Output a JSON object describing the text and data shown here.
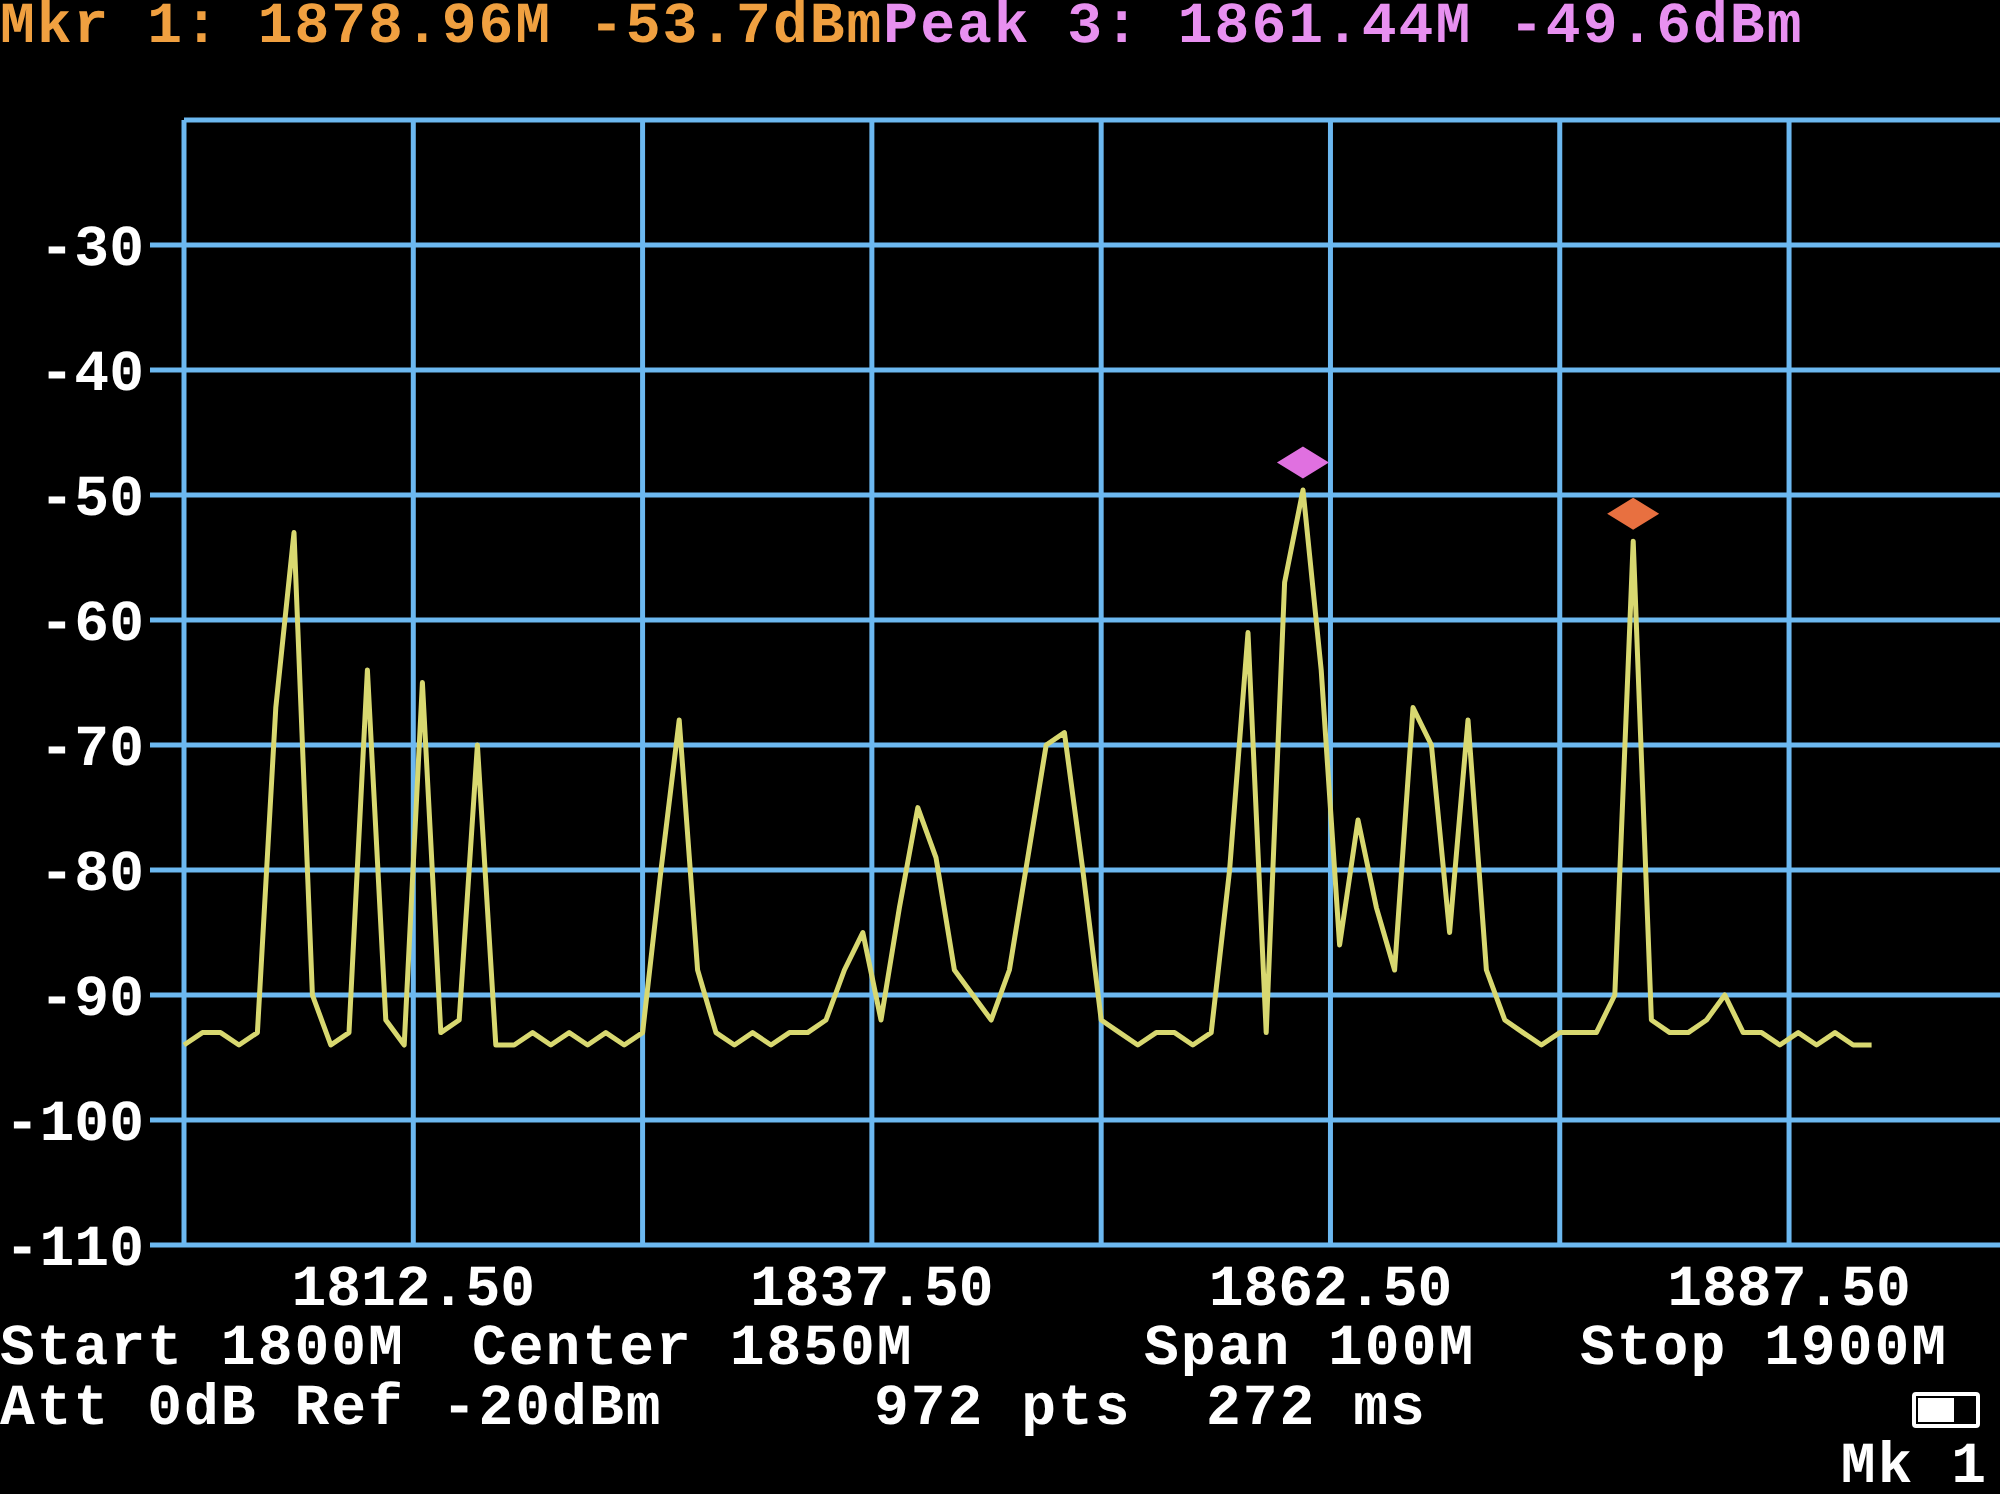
{
  "header": {
    "marker_readout": "Mkr 1: 1878.96M -53.7dBm",
    "peak_readout": "Peak 3: 1861.44M -49.6dBm"
  },
  "chart": {
    "chart_data": {
      "type": "line",
      "grid": true,
      "xlim": [
        1800,
        1899
      ],
      "ylim": [
        -110,
        -20
      ],
      "yticks": [
        -30,
        -40,
        -50,
        -60,
        -70,
        -80,
        -90,
        -100,
        -110
      ],
      "xticks": [
        {
          "value": 1812.5,
          "label": "1812.50"
        },
        {
          "value": 1837.5,
          "label": "1837.50"
        },
        {
          "value": 1862.5,
          "label": "1862.50"
        },
        {
          "value": 1887.5,
          "label": "1887.50"
        }
      ],
      "x": [
        1800,
        1801,
        1802,
        1803,
        1804,
        1805,
        1806,
        1807,
        1808,
        1809,
        1810,
        1811,
        1812,
        1813,
        1814,
        1815,
        1816,
        1817,
        1818,
        1819,
        1820,
        1821,
        1822,
        1823,
        1824,
        1825,
        1826,
        1827,
        1828,
        1829,
        1830,
        1831,
        1832,
        1833,
        1834,
        1835,
        1836,
        1837,
        1838,
        1839,
        1840,
        1841,
        1842,
        1843,
        1844,
        1845,
        1846,
        1847,
        1848,
        1849,
        1850,
        1851,
        1852,
        1853,
        1854,
        1855,
        1856,
        1857,
        1858,
        1859,
        1860,
        1861,
        1862,
        1863,
        1864,
        1865,
        1866,
        1867,
        1868,
        1869,
        1870,
        1871,
        1872,
        1873,
        1874,
        1875,
        1876,
        1877,
        1878,
        1879,
        1880,
        1881,
        1882,
        1883,
        1884,
        1885,
        1886,
        1887,
        1888,
        1889,
        1890,
        1891,
        1892
      ],
      "series": [
        {
          "color": "#d8d870",
          "values": [
            -94,
            -93,
            -93,
            -94,
            -93,
            -67,
            -53,
            -90,
            -94,
            -93,
            -64,
            -92,
            -94,
            -65,
            -93,
            -92,
            -70,
            -94,
            -94,
            -93,
            -94,
            -93,
            -94,
            -93,
            -94,
            -93,
            -80,
            -68,
            -88,
            -93,
            -94,
            -93,
            -94,
            -93,
            -93,
            -92,
            -88,
            -85,
            -92,
            -83,
            -75,
            -79,
            -88,
            -90,
            -92,
            -88,
            -79,
            -70,
            -69,
            -80,
            -92,
            -93,
            -94,
            -93,
            -93,
            -94,
            -93,
            -80,
            -61,
            -93,
            -57,
            -49.6,
            -64,
            -86,
            -76,
            -83,
            -88,
            -67,
            -70,
            -85,
            -68,
            -88,
            -92,
            -93,
            -94,
            -93,
            -93,
            -93,
            -90,
            -53.7,
            -92,
            -93,
            -93,
            -92,
            -90,
            -93,
            -93,
            -94,
            -93,
            -94,
            -93,
            -94,
            -94
          ]
        },
        {
          "color": "#e070e0",
          "marker": "diamond",
          "values": [
            null,
            null,
            null,
            null,
            null,
            null,
            null,
            null,
            null,
            null,
            null,
            null,
            null,
            null,
            null,
            null,
            null,
            null,
            null,
            null,
            null,
            null,
            null,
            null,
            null,
            null,
            null,
            null,
            null,
            null,
            null,
            null,
            null,
            null,
            null,
            null,
            null,
            null,
            null,
            null,
            null,
            null,
            null,
            null,
            null,
            null,
            null,
            null,
            null,
            null,
            null,
            null,
            null,
            null,
            null,
            null,
            null,
            null,
            null,
            null,
            null,
            -47.4,
            null,
            null,
            null,
            null,
            null,
            null,
            null,
            null,
            null,
            null,
            null,
            null,
            null,
            null,
            null,
            null,
            null,
            null,
            null,
            null,
            null,
            null,
            null,
            null,
            null,
            null,
            null,
            null,
            null,
            null,
            null
          ]
        },
        {
          "color": "#e87040",
          "marker": "diamond",
          "values": [
            null,
            null,
            null,
            null,
            null,
            null,
            null,
            null,
            null,
            null,
            null,
            null,
            null,
            null,
            null,
            null,
            null,
            null,
            null,
            null,
            null,
            null,
            null,
            null,
            null,
            null,
            null,
            null,
            null,
            null,
            null,
            null,
            null,
            null,
            null,
            null,
            null,
            null,
            null,
            null,
            null,
            null,
            null,
            null,
            null,
            null,
            null,
            null,
            null,
            null,
            null,
            null,
            null,
            null,
            null,
            null,
            null,
            null,
            null,
            null,
            null,
            null,
            null,
            null,
            null,
            null,
            null,
            null,
            null,
            null,
            null,
            null,
            null,
            null,
            null,
            null,
            null,
            null,
            null,
            -51.5,
            null,
            null,
            null,
            null,
            null,
            null,
            null,
            null,
            null,
            null,
            null,
            null,
            null
          ]
        }
      ]
    }
  },
  "status": {
    "start": "Start 1800M",
    "center": "Center 1850M",
    "span": "Span 100M",
    "stop": "Stop 1900M",
    "att_ref": "Att 0dB Ref -20dBm",
    "points": "972 pts",
    "sweep_time": "272 ms",
    "marker_label": "Mk 1"
  }
}
